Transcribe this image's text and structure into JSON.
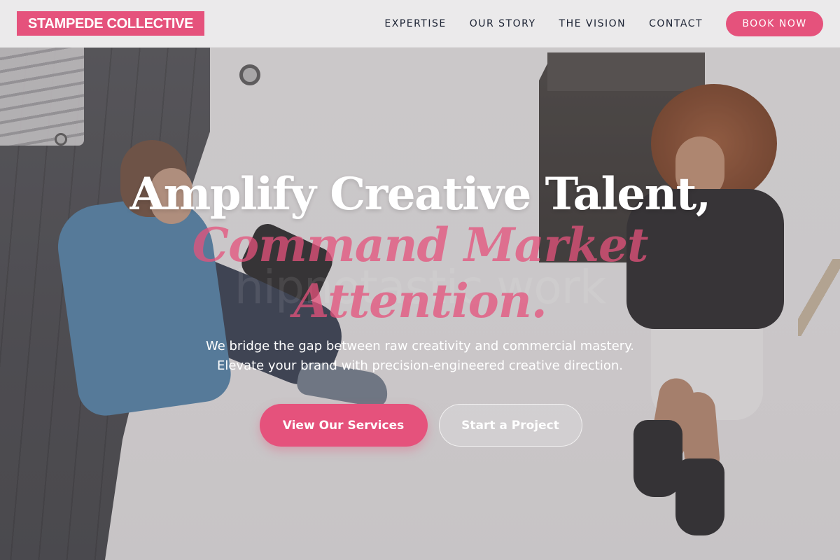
{
  "header": {
    "logo": "STAMPEDE COLLECTIVE",
    "nav": [
      {
        "label": "EXPERTISE"
      },
      {
        "label": "OUR STORY"
      },
      {
        "label": "THE VISION"
      },
      {
        "label": "CONTACT"
      }
    ],
    "cta_label": "BOOK NOW"
  },
  "hero": {
    "headline": "Amplify Creative Talent,",
    "sub_headline_line1": "Command Market",
    "sub_headline_line2": "Attention.",
    "ghost_text": "hipnotastic work",
    "description_line1": "We bridge the gap between raw creativity and commercial mastery.",
    "description_line2": "Elevate your brand with precision-engineered creative direction.",
    "primary_button": "View Our Services",
    "secondary_button": "Start a Project"
  },
  "colors": {
    "accent": "#e5527c",
    "header_bg": "#ecebec",
    "nav_text": "#1b2233"
  }
}
